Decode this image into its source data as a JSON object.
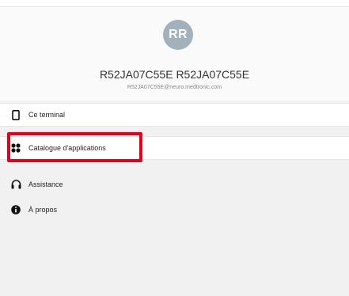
{
  "profile": {
    "avatar_initials": "RR",
    "name": "R52JA07C55E R52JA07C55E",
    "email": "R52JA07C55E@neuro.medtronic.com"
  },
  "menu": {
    "items": [
      {
        "label": "Ce terminal",
        "icon": "phone-icon"
      },
      {
        "label": "Catalogue d'applications",
        "icon": "apps-grid-icon"
      },
      {
        "label": "Assistance",
        "icon": "headset-icon"
      },
      {
        "label": "À propos",
        "icon": "info-icon"
      }
    ]
  },
  "colors": {
    "avatar": "#a3b1bd",
    "highlight": "#e3001b",
    "background": "#f1f1f1"
  }
}
